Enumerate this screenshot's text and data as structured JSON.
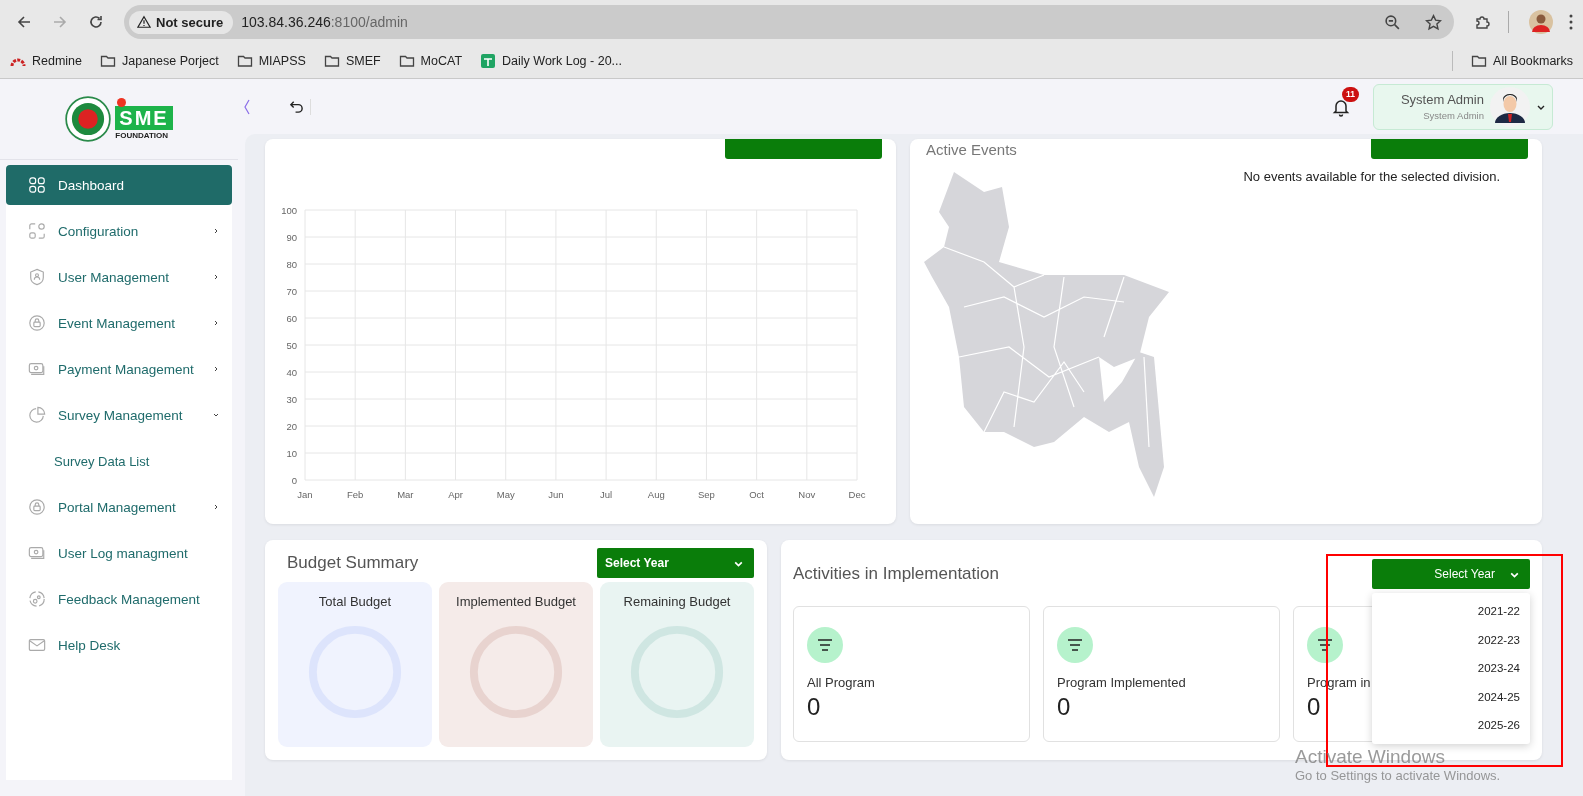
{
  "browser": {
    "security_label": "Not secure",
    "url_host": "103.84.36.246",
    "url_path": ":8100/admin",
    "bookmarks": [
      {
        "kind": "redmine",
        "label": "Redmine"
      },
      {
        "kind": "folder",
        "label": "Japanese Porject"
      },
      {
        "kind": "folder",
        "label": "MIAPSS"
      },
      {
        "kind": "folder",
        "label": "SMEF"
      },
      {
        "kind": "folder",
        "label": "MoCAT"
      },
      {
        "kind": "sheet",
        "label": "Daily Work Log - 20..."
      }
    ],
    "all_bookmarks": "All Bookmarks"
  },
  "logo": {
    "mark": "SME",
    "caption": "FOUNDATION"
  },
  "sidebar": {
    "items": [
      {
        "label": "Dashboard",
        "selected": true
      },
      {
        "label": "Configuration",
        "selected": false,
        "expanded": false
      },
      {
        "label": "User Management",
        "selected": false,
        "expanded": false
      },
      {
        "label": "Event Management",
        "selected": false,
        "expanded": false
      },
      {
        "label": "Payment Management",
        "selected": false,
        "expanded": false
      },
      {
        "label": "Survey Management",
        "selected": false,
        "expanded": true,
        "children": [
          {
            "label": "Survey Data List",
            "selected": false
          }
        ]
      },
      {
        "label": "Portal Management",
        "selected": false,
        "expanded": false
      },
      {
        "label": "User Log managment",
        "selected": false
      },
      {
        "label": "Feedback Management",
        "selected": false
      },
      {
        "label": "Help Desk",
        "selected": false
      }
    ]
  },
  "header": {
    "notification_count": "11",
    "user_name": "System Admin",
    "user_role": "System Admin"
  },
  "monthly_chart": {
    "chart_data": {
      "type": "line",
      "grid": true,
      "categories": [
        "Jan",
        "Feb",
        "Mar",
        "Apr",
        "May",
        "Jun",
        "Jul",
        "Aug",
        "Sep",
        "Oct",
        "Nov",
        "Dec"
      ],
      "ylim": [
        0,
        100
      ],
      "yticks": [
        0,
        10,
        20,
        30,
        40,
        50,
        60,
        70,
        80,
        90,
        100
      ]
    }
  },
  "active_events": {
    "title": "Active Events",
    "message": "No events available for the selected division."
  },
  "budget_summary": {
    "title": "Budget Summary",
    "year_select": "Select Year",
    "tiles": [
      {
        "label": "Total Budget",
        "color": "#dde4fc"
      },
      {
        "label": "Implemented Budget",
        "color": "#e8d3cf"
      },
      {
        "label": "Remaining Budget",
        "color": "#cfe6e2"
      }
    ]
  },
  "activities": {
    "title": "Activities in Implementation",
    "year_select": {
      "label": "Select Year",
      "expanded": true,
      "options": [
        {
          "label": "2021-22",
          "selected": false
        },
        {
          "label": "2022-23",
          "selected": false
        },
        {
          "label": "2023-24",
          "selected": false
        },
        {
          "label": "2024-25",
          "selected": false
        },
        {
          "label": "2025-26",
          "selected": false
        }
      ]
    },
    "stats": [
      {
        "label": "All Program",
        "value": "0"
      },
      {
        "label": "Program Implemented",
        "value": "0"
      },
      {
        "label": "Program in",
        "value": "0"
      }
    ]
  },
  "os_notice": {
    "title": "Activate Windows",
    "hint": "Go to Settings to activate Windows."
  }
}
